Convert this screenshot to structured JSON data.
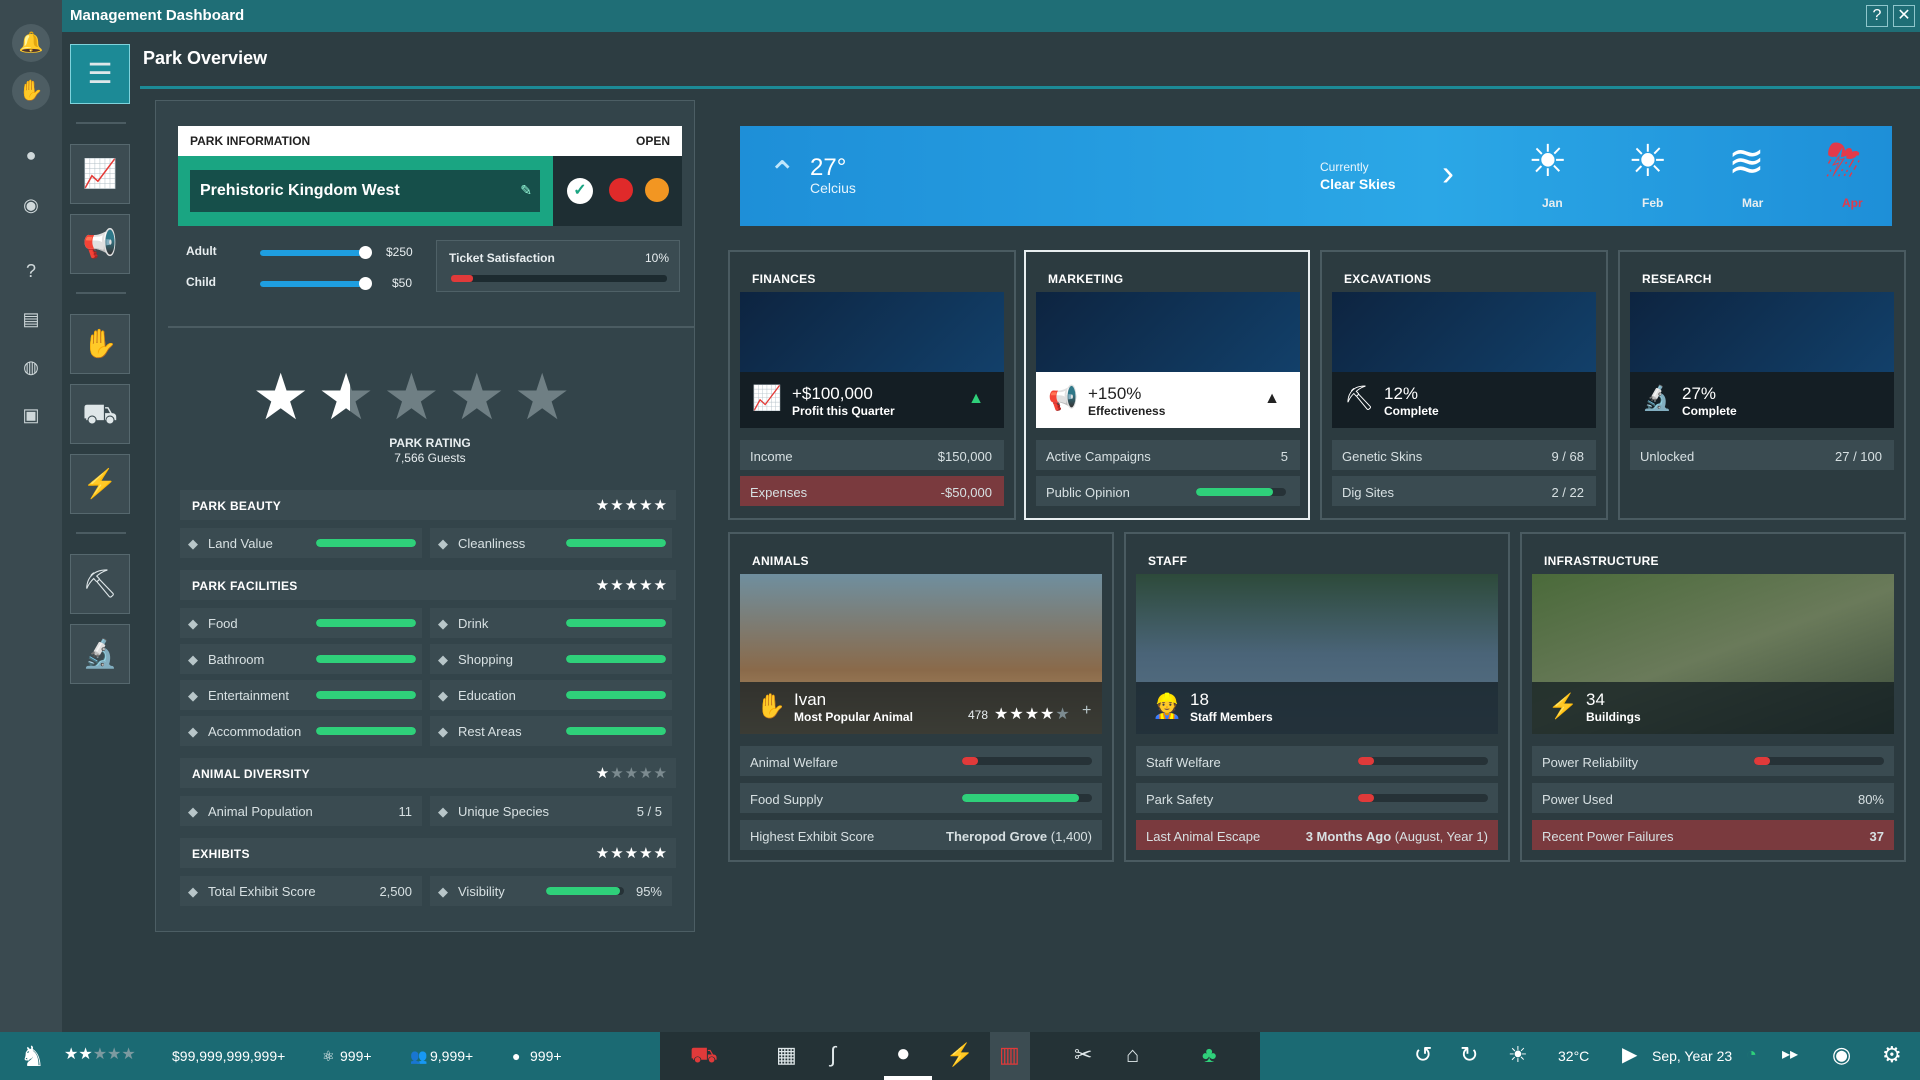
{
  "window": {
    "title": "Management Dashboard",
    "help_label": "?",
    "close_label": "✕"
  },
  "page_title": "Park Overview",
  "park_info": {
    "header": "PARK INFORMATION",
    "status": "OPEN",
    "park_name": "Prehistoric Kingdom West",
    "adult_label": "Adult",
    "adult_price": "$250",
    "adult_level": 0.95,
    "child_label": "Child",
    "child_price": "$50",
    "child_level": 0.95,
    "ticket_satisfaction_label": "Ticket Satisfaction",
    "ticket_satisfaction_value": "10%",
    "ticket_satisfaction_level": 0.1
  },
  "rating": {
    "label": "PARK RATING",
    "guests": "7,566 Guests",
    "stars": 1.5
  },
  "sections": [
    {
      "title": "PARK BEAUTY",
      "stars": 5,
      "items": [
        {
          "label": "Land Value",
          "level": 1.0
        },
        {
          "label": "Cleanliness",
          "level": 1.0
        }
      ]
    },
    {
      "title": "PARK FACILITIES",
      "stars": 5,
      "items": [
        {
          "label": "Food",
          "level": 1.0
        },
        {
          "label": "Drink",
          "level": 1.0
        },
        {
          "label": "Bathroom",
          "level": 1.0
        },
        {
          "label": "Shopping",
          "level": 1.0
        },
        {
          "label": "Entertainment",
          "level": 1.0
        },
        {
          "label": "Education",
          "level": 1.0
        },
        {
          "label": "Accommodation",
          "level": 1.0
        },
        {
          "label": "Rest Areas",
          "level": 1.0
        }
      ]
    },
    {
      "title": "ANIMAL DIVERSITY",
      "stars": 1,
      "items": [
        {
          "label": "Animal Population",
          "value": "11"
        },
        {
          "label": "Unique Species",
          "value": "5 / 5"
        }
      ]
    },
    {
      "title": "EXHIBITS",
      "stars": 5,
      "items": [
        {
          "label": "Total Exhibit Score",
          "value": "2,500"
        },
        {
          "label": "Visibility",
          "value": "95%",
          "level": 0.95
        }
      ]
    }
  ],
  "weather": {
    "temp": "27°",
    "unit": "Celcius",
    "currently": "Currently",
    "condition": "Clear Skies",
    "months": [
      "Jan",
      "Feb",
      "Mar",
      "Apr"
    ]
  },
  "finances": {
    "title": "FINANCES",
    "headline": "+$100,000",
    "sub": "Profit this Quarter",
    "rows": [
      {
        "label": "Income",
        "value": "$150,000"
      },
      {
        "label": "Expenses",
        "value": "-$50,000"
      }
    ]
  },
  "marketing": {
    "title": "MARKETING",
    "headline": "+150%",
    "sub": "Effectiveness",
    "rows": [
      {
        "label": "Active Campaigns",
        "value": "5"
      },
      {
        "label": "Public Opinion",
        "level": 0.85
      }
    ]
  },
  "excavations": {
    "title": "EXCAVATIONS",
    "headline": "12%",
    "sub": "Complete",
    "rows": [
      {
        "label": "Genetic Skins",
        "value": "9 / 68"
      },
      {
        "label": "Dig Sites",
        "value": "2 / 22"
      }
    ]
  },
  "research": {
    "title": "RESEARCH",
    "headline": "27%",
    "sub": "Complete",
    "rows": [
      {
        "label": "Unlocked",
        "value": "27 / 100"
      }
    ]
  },
  "animals": {
    "title": "ANIMALS",
    "headline": "Ivan",
    "sub": "Most Popular Animal",
    "score": "478",
    "stars": 4,
    "rows": [
      {
        "label": "Animal Welfare",
        "level": 0.05
      },
      {
        "label": "Food Supply",
        "level": 0.9
      },
      {
        "label": "Highest Exhibit Score",
        "value_bold": "Theropod Grove",
        "value": "(1,400)"
      }
    ]
  },
  "staff": {
    "title": "STAFF",
    "headline": "18",
    "sub": "Staff Members",
    "rows": [
      {
        "label": "Staff Welfare",
        "level": 0.05
      },
      {
        "label": "Park Safety",
        "level": 0.05
      },
      {
        "label": "Last Animal Escape",
        "value_bold": "3 Months Ago",
        "value": "(August, Year 1)"
      }
    ]
  },
  "infrastructure": {
    "title": "INFRASTRUCTURE",
    "headline": "34",
    "sub": "Buildings",
    "rows": [
      {
        "label": "Power Reliability",
        "level": 0.05
      },
      {
        "label": "Power Used",
        "value": "80%"
      },
      {
        "label": "Recent Power Failures",
        "value": "37"
      }
    ]
  },
  "bottom": {
    "money": "$99,999,999,999+",
    "science": "999+",
    "guests": "9,999+",
    "eggs": "999+",
    "temp": "32°C",
    "date": "Sep, Year 23"
  }
}
